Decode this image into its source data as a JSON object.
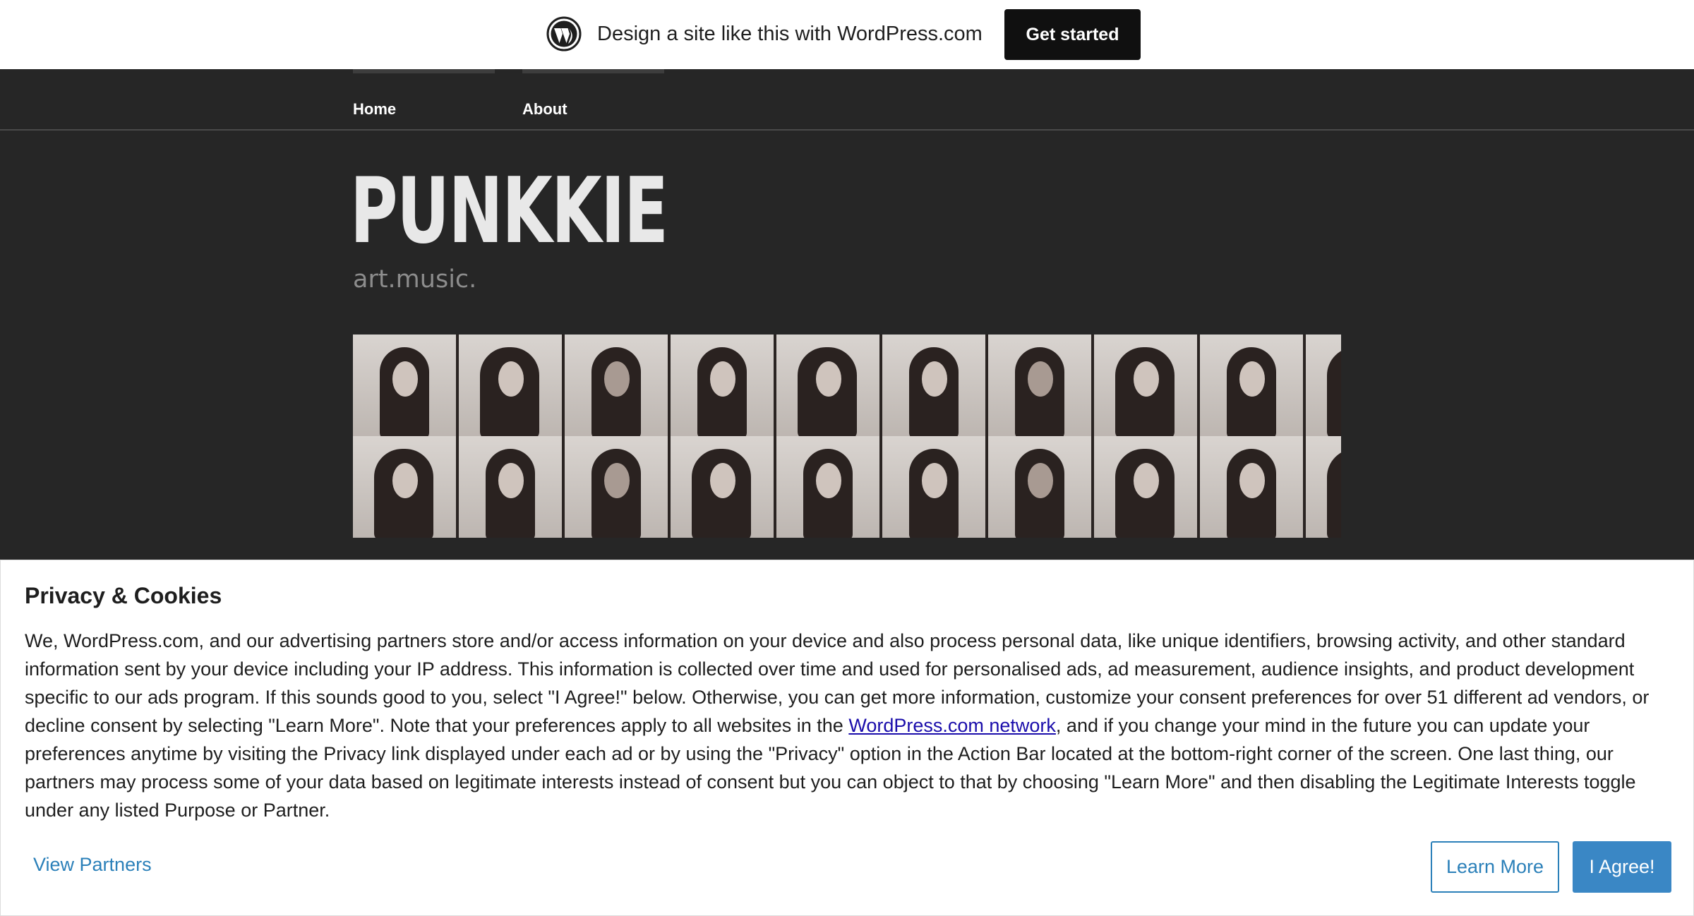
{
  "banner": {
    "logo_icon": "wordpress-logo-icon",
    "text": "Design a site like this with WordPress.com",
    "cta_label": "Get started"
  },
  "nav": {
    "items": [
      {
        "label": "Home"
      },
      {
        "label": "About"
      }
    ]
  },
  "header": {
    "title": "PUNKKIE",
    "tagline": "art.music."
  },
  "gallery": {
    "description_icon": "photo-booth-strip-image"
  },
  "privacy": {
    "title": "Privacy & Cookies",
    "body_before_link": "We, WordPress.com, and our advertising partners store and/or access information on your device and also process personal data, like unique identifiers, browsing activity, and other standard information sent by your device including your IP address. This information is collected over time and used for personalised ads, ad measurement, audience insights, and product development specific to our ads program. If this sounds good to you, select \"I Agree!\" below. Otherwise, you can get more information, customize your consent preferences for over 51 different ad vendors, or decline consent by selecting \"Learn More\". Note that your preferences apply to all websites in the ",
    "link_text": "WordPress.com network",
    "body_after_link": ", and if you change your mind in the future you can update your preferences anytime by visiting the Privacy link displayed under each ad or by using the \"Privacy\" option in the Action Bar located at the bottom-right corner of the screen. One last thing, our partners may process some of your data based on legitimate interests instead of consent but you can object to that by choosing \"Learn More\" and then disabling the Legitimate Interests toggle under any listed Purpose or Partner.",
    "view_partners_label": "View Partners",
    "learn_more_label": "Learn More",
    "agree_label": "I Agree!"
  },
  "colors": {
    "page_bg": "#262626",
    "accent_blue": "#3a87c5",
    "cta_bg": "#101010"
  }
}
